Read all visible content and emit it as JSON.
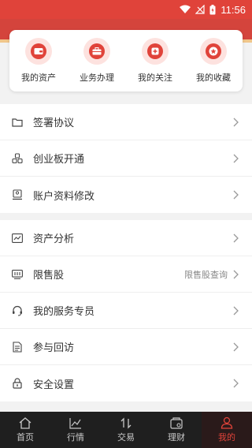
{
  "status_bar": {
    "time": "11:56"
  },
  "quick_actions": [
    {
      "label": "我的资产",
      "icon": "wallet-icon"
    },
    {
      "label": "业务办理",
      "icon": "briefcase-icon"
    },
    {
      "label": "我的关注",
      "icon": "plus-icon"
    },
    {
      "label": "我的收藏",
      "icon": "star-icon"
    }
  ],
  "section1": [
    {
      "label": "签署协议",
      "icon": "folder-icon"
    },
    {
      "label": "创业板开通",
      "icon": "blocks-icon"
    },
    {
      "label": "账户资料修改",
      "icon": "edit-profile-icon"
    }
  ],
  "section2": [
    {
      "label": "资产分析",
      "icon": "line-chart-icon"
    },
    {
      "label": "限售股",
      "extra": "限售股查询",
      "icon": "restricted-shares-icon"
    },
    {
      "label": "我的服务专员",
      "icon": "headset-icon"
    },
    {
      "label": "参与回访",
      "icon": "document-icon"
    },
    {
      "label": "安全设置",
      "icon": "lock-icon"
    }
  ],
  "bottom_nav": [
    {
      "label": "首页",
      "icon": "home-icon",
      "active": false
    },
    {
      "label": "行情",
      "icon": "market-chart-icon",
      "active": false
    },
    {
      "label": "交易",
      "icon": "trade-icon",
      "active": false
    },
    {
      "label": "理财",
      "icon": "finance-icon",
      "active": false
    },
    {
      "label": "我的",
      "icon": "user-icon",
      "active": true
    }
  ],
  "colors": {
    "accent": "#e0433a",
    "nav_bg": "#1f1f1f"
  }
}
